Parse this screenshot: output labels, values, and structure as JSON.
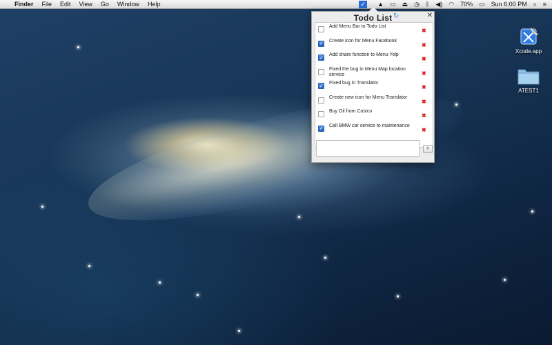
{
  "menubar": {
    "app_name": "Finder",
    "menus": [
      "File",
      "Edit",
      "View",
      "Go",
      "Window",
      "Help"
    ],
    "battery": "70%",
    "clock": "Sun 6:00 PM"
  },
  "popover": {
    "title": "Todo List",
    "items": [
      {
        "text": "Add Menu Bar to Todo List",
        "checked": false
      },
      {
        "text": "Create icon for Menu Facebook",
        "checked": true
      },
      {
        "text": "Add share function to Menu Yelp",
        "checked": true
      },
      {
        "text": "Fixed the bug in Menu Map location service",
        "checked": false
      },
      {
        "text": "Fixed bug in Translator",
        "checked": true
      },
      {
        "text": "Create new icon for Menu Translator",
        "checked": false
      },
      {
        "text": "Buy Oil from Costco",
        "checked": false
      },
      {
        "text": "Call BMW car service to maintenance",
        "checked": true
      }
    ],
    "new_item_value": "",
    "add_label": "+"
  },
  "desktop_icons": [
    {
      "label": "Xcode.app",
      "icon": "xcode-icon"
    },
    {
      "label": "ATEST1",
      "icon": "folder-icon"
    }
  ],
  "colors": {
    "accent": "#2a6fd6",
    "delete": "#d82222"
  }
}
